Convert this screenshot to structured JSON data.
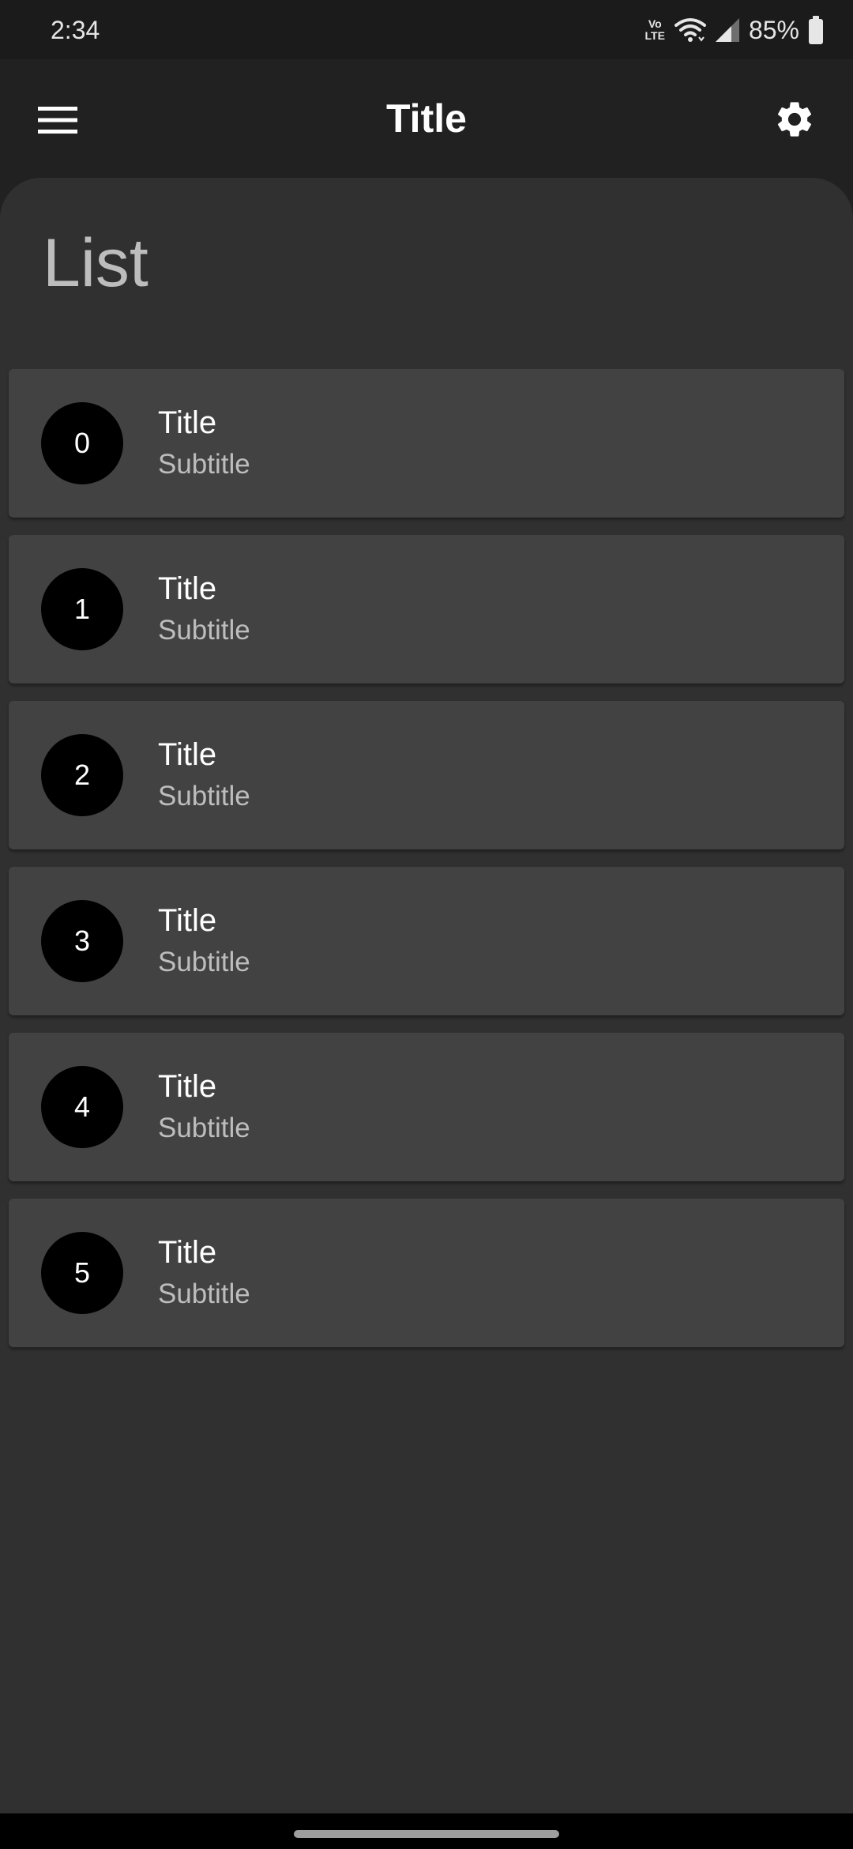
{
  "status_bar": {
    "time": "2:34",
    "volte_top": "Vo",
    "volte_bottom": "LTE",
    "battery_percent": "85%",
    "battery_level": 0.85
  },
  "app_bar": {
    "title": "Title",
    "menu_icon": "hamburger-menu-icon",
    "settings_icon": "gear-icon"
  },
  "list": {
    "heading": "List",
    "items": [
      {
        "avatar": "0",
        "title": "Title",
        "subtitle": "Subtitle"
      },
      {
        "avatar": "1",
        "title": "Title",
        "subtitle": "Subtitle"
      },
      {
        "avatar": "2",
        "title": "Title",
        "subtitle": "Subtitle"
      },
      {
        "avatar": "3",
        "title": "Title",
        "subtitle": "Subtitle"
      },
      {
        "avatar": "4",
        "title": "Title",
        "subtitle": "Subtitle"
      },
      {
        "avatar": "5",
        "title": "Title",
        "subtitle": "Subtitle"
      }
    ]
  },
  "colors": {
    "app_bar_bg": "#212121",
    "sheet_bg": "#303030",
    "card_bg": "#424242",
    "avatar_bg": "#000000",
    "title_text": "#ffffff",
    "subtitle_text": "#bdbdbd"
  }
}
